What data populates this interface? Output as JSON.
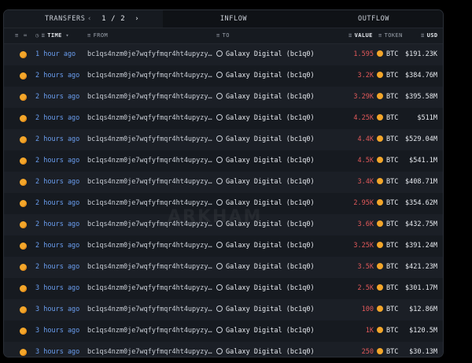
{
  "tabs": {
    "transfers": "TRANSFERS",
    "page_current": "1",
    "page_separator": "/",
    "page_total": "2",
    "inflow": "INFLOW",
    "outflow": "OUTFLOW"
  },
  "columns": {
    "time": "TIME",
    "from": "FROM",
    "to": "TO",
    "value": "VALUE",
    "token": "TOKEN",
    "usd": "USD"
  },
  "watermark": "ARKHAM",
  "colors": {
    "accent_time": "#6a9ef0",
    "value_out": "#e2595a",
    "btc": "#f4a62a"
  },
  "rows": [
    {
      "time": "1 hour ago",
      "from": "bc1qs4nzm0je7wqfyfmqr4ht4upyzy5...",
      "to": "Galaxy Digital (bc1q0)",
      "value": "1.595",
      "token": "BTC",
      "usd": "$191.23K"
    },
    {
      "time": "2 hours ago",
      "from": "bc1qs4nzm0je7wqfyfmqr4ht4upyzy5...",
      "to": "Galaxy Digital (bc1q0)",
      "value": "3.2K",
      "token": "BTC",
      "usd": "$384.76M"
    },
    {
      "time": "2 hours ago",
      "from": "bc1qs4nzm0je7wqfyfmqr4ht4upyzy5...",
      "to": "Galaxy Digital (bc1q0)",
      "value": "3.29K",
      "token": "BTC",
      "usd": "$395.58M"
    },
    {
      "time": "2 hours ago",
      "from": "bc1qs4nzm0je7wqfyfmqr4ht4upyzy5...",
      "to": "Galaxy Digital (bc1q0)",
      "value": "4.25K",
      "token": "BTC",
      "usd": "$511M"
    },
    {
      "time": "2 hours ago",
      "from": "bc1qs4nzm0je7wqfyfmqr4ht4upyzy5...",
      "to": "Galaxy Digital (bc1q0)",
      "value": "4.4K",
      "token": "BTC",
      "usd": "$529.04M"
    },
    {
      "time": "2 hours ago",
      "from": "bc1qs4nzm0je7wqfyfmqr4ht4upyzy5...",
      "to": "Galaxy Digital (bc1q0)",
      "value": "4.5K",
      "token": "BTC",
      "usd": "$541.1M"
    },
    {
      "time": "2 hours ago",
      "from": "bc1qs4nzm0je7wqfyfmqr4ht4upyzy5...",
      "to": "Galaxy Digital (bc1q0)",
      "value": "3.4K",
      "token": "BTC",
      "usd": "$408.71M"
    },
    {
      "time": "2 hours ago",
      "from": "bc1qs4nzm0je7wqfyfmqr4ht4upyzy5...",
      "to": "Galaxy Digital (bc1q0)",
      "value": "2.95K",
      "token": "BTC",
      "usd": "$354.62M"
    },
    {
      "time": "2 hours ago",
      "from": "bc1qs4nzm0je7wqfyfmqr4ht4upyzy5...",
      "to": "Galaxy Digital (bc1q0)",
      "value": "3.6K",
      "token": "BTC",
      "usd": "$432.75M"
    },
    {
      "time": "2 hours ago",
      "from": "bc1qs4nzm0je7wqfyfmqr4ht4upyzy5...",
      "to": "Galaxy Digital (bc1q0)",
      "value": "3.25K",
      "token": "BTC",
      "usd": "$391.24M"
    },
    {
      "time": "2 hours ago",
      "from": "bc1qs4nzm0je7wqfyfmqr4ht4upyzy5...",
      "to": "Galaxy Digital (bc1q0)",
      "value": "3.5K",
      "token": "BTC",
      "usd": "$421.23M"
    },
    {
      "time": "3 hours ago",
      "from": "bc1qs4nzm0je7wqfyfmqr4ht4upyzy5...",
      "to": "Galaxy Digital (bc1q0)",
      "value": "2.5K",
      "token": "BTC",
      "usd": "$301.17M"
    },
    {
      "time": "3 hours ago",
      "from": "bc1qs4nzm0je7wqfyfmqr4ht4upyzy5...",
      "to": "Galaxy Digital (bc1q0)",
      "value": "100",
      "token": "BTC",
      "usd": "$12.86M"
    },
    {
      "time": "3 hours ago",
      "from": "bc1qs4nzm0je7wqfyfmqr4ht4upyzy5...",
      "to": "Galaxy Digital (bc1q0)",
      "value": "1K",
      "token": "BTC",
      "usd": "$120.5M"
    },
    {
      "time": "3 hours ago",
      "from": "bc1qs4nzm0je7wqfyfmqr4ht4upyzy5...",
      "to": "Galaxy Digital (bc1q0)",
      "value": "250",
      "token": "BTC",
      "usd": "$30.13M"
    }
  ]
}
